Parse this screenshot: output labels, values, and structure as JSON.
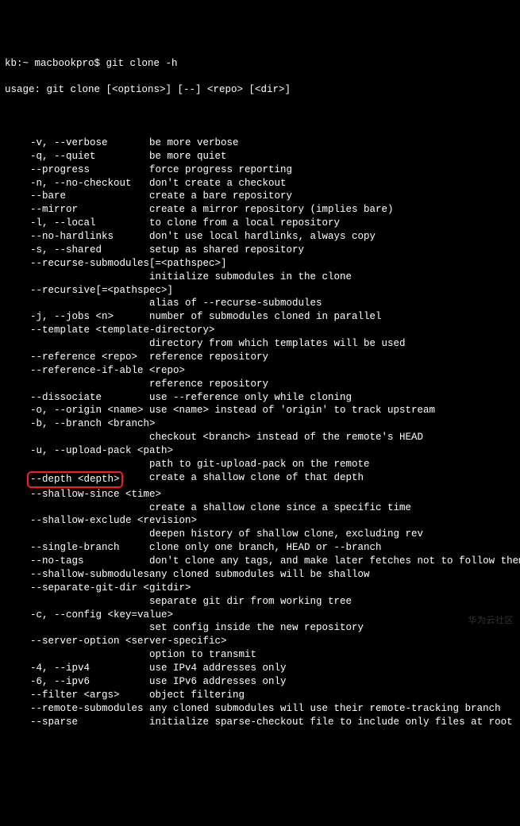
{
  "prompt": "kb:~ macbookpro$ ",
  "command": "git clone -h",
  "usage": "usage: git clone [<options>] [--] <repo> [<dir>]",
  "options": [
    {
      "flag": "-v, --verbose",
      "desc": "be more verbose"
    },
    {
      "flag": "-q, --quiet",
      "desc": "be more quiet"
    },
    {
      "flag": "--progress",
      "desc": "force progress reporting"
    },
    {
      "flag": "-n, --no-checkout",
      "desc": "don't create a checkout"
    },
    {
      "flag": "--bare",
      "desc": "create a bare repository"
    },
    {
      "flag": "--mirror",
      "desc": "create a mirror repository (implies bare)"
    },
    {
      "flag": "-l, --local",
      "desc": "to clone from a local repository"
    },
    {
      "flag": "--no-hardlinks",
      "desc": "don't use local hardlinks, always copy"
    },
    {
      "flag": "-s, --shared",
      "desc": "setup as shared repository"
    },
    {
      "flag": "--recurse-submodules[=<pathspec>]",
      "desc": "",
      "wrap": true
    },
    {
      "flag": "",
      "desc": "initialize submodules in the clone"
    },
    {
      "flag": "--recursive[=<pathspec>]",
      "desc": "",
      "wrap": true
    },
    {
      "flag": "",
      "desc": "alias of --recurse-submodules"
    },
    {
      "flag": "-j, --jobs <n>",
      "desc": "number of submodules cloned in parallel"
    },
    {
      "flag": "--template <template-directory>",
      "desc": "",
      "wrap": true
    },
    {
      "flag": "",
      "desc": "directory from which templates will be used"
    },
    {
      "flag": "--reference <repo>",
      "desc": "reference repository"
    },
    {
      "flag": "--reference-if-able <repo>",
      "desc": "",
      "wrap": true
    },
    {
      "flag": "",
      "desc": "reference repository"
    },
    {
      "flag": "--dissociate",
      "desc": "use --reference only while cloning"
    },
    {
      "flag": "-o, --origin <name>",
      "desc": "use <name> instead of 'origin' to track upstream"
    },
    {
      "flag": "-b, --branch <branch>",
      "desc": "",
      "wrap": true
    },
    {
      "flag": "",
      "desc": "checkout <branch> instead of the remote's HEAD"
    },
    {
      "flag": "-u, --upload-pack <path>",
      "desc": "",
      "wrap": true
    },
    {
      "flag": "",
      "desc": "path to git-upload-pack on the remote"
    },
    {
      "flag": "--depth <depth>",
      "desc": "create a shallow clone of that depth",
      "highlight": true
    },
    {
      "flag": "--shallow-since <time>",
      "desc": "",
      "wrap": true
    },
    {
      "flag": "",
      "desc": "create a shallow clone since a specific time"
    },
    {
      "flag": "--shallow-exclude <revision>",
      "desc": "",
      "wrap": true
    },
    {
      "flag": "",
      "desc": "deepen history of shallow clone, excluding rev"
    },
    {
      "flag": "--single-branch",
      "desc": "clone only one branch, HEAD or --branch"
    },
    {
      "flag": "--no-tags",
      "desc": "don't clone any tags, and make later fetches not to follow them"
    },
    {
      "flag": "--shallow-submodules",
      "desc": "any cloned submodules will be shallow"
    },
    {
      "flag": "--separate-git-dir <gitdir>",
      "desc": "",
      "wrap": true
    },
    {
      "flag": "",
      "desc": "separate git dir from working tree"
    },
    {
      "flag": "-c, --config <key=value>",
      "desc": "",
      "wrap": true
    },
    {
      "flag": "",
      "desc": "set config inside the new repository"
    },
    {
      "flag": "--server-option <server-specific>",
      "desc": "",
      "wrap": true
    },
    {
      "flag": "",
      "desc": "option to transmit"
    },
    {
      "flag": "-4, --ipv4",
      "desc": "use IPv4 addresses only"
    },
    {
      "flag": "-6, --ipv6",
      "desc": "use IPv6 addresses only"
    },
    {
      "flag": "--filter <args>",
      "desc": "object filtering"
    },
    {
      "flag": "--remote-submodules",
      "desc": "any cloned submodules will use their remote-tracking branch"
    },
    {
      "flag": "--sparse",
      "desc": "initialize sparse-checkout file to include only files at root"
    }
  ],
  "watermark": "华为云社区"
}
